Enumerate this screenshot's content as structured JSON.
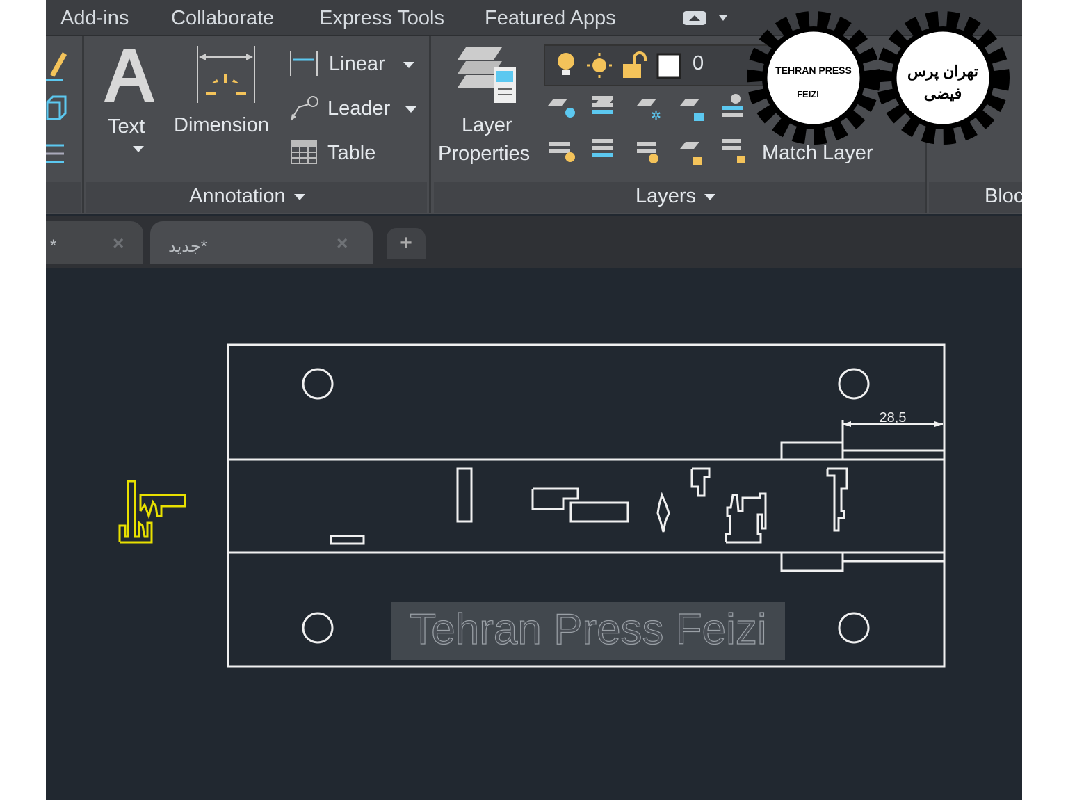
{
  "menu": {
    "items": [
      "Add-ins",
      "Collaborate",
      "Express Tools",
      "Featured Apps"
    ]
  },
  "ribbon": {
    "annotation": {
      "text_label": "Text",
      "dimension_label": "Dimension",
      "linear_label": "Linear",
      "leader_label": "Leader",
      "table_label": "Table",
      "panel_label": "Annotation"
    },
    "layers": {
      "layer_properties_line1": "Layer",
      "layer_properties_line2": "Properties",
      "current_layer": "0",
      "match_layer_label": "Match Layer",
      "panel_label": "Layers"
    },
    "block": {
      "panel_label": "Bloc"
    }
  },
  "tabs": [
    {
      "title": "*",
      "active": false
    },
    {
      "title": "جدید*",
      "active": true
    }
  ],
  "new_tab_label": "+",
  "drawing": {
    "dimension_value": "28,5",
    "watermark": "Tehran Press Feizi",
    "selected_color": "#e8e000",
    "line_color": "#ffffff"
  },
  "logos": {
    "english": {
      "line1": "TEHRAN PRESS",
      "line2": "FEIZI"
    },
    "persian": {
      "line1": "تهران پرس",
      "line2": "فیضی"
    }
  },
  "colors": {
    "canvas_bg": "#212830",
    "ribbon_bg": "#4a4c50",
    "accent_yellow": "#f4c35a",
    "accent_blue": "#5cc8f0"
  }
}
